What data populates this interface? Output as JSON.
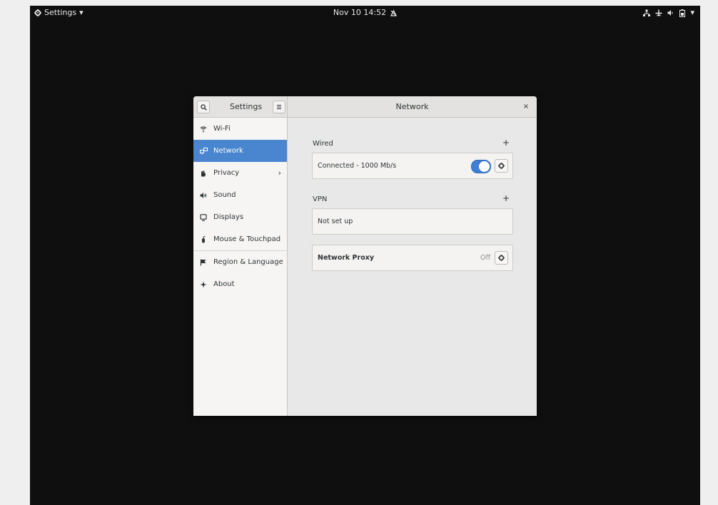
{
  "topbar": {
    "app_menu_label": "Settings",
    "app_menu_arrow": "▾",
    "clock": "Nov 10  14:52",
    "notification_icon": "alarm-icon",
    "tray_arrow": "▾"
  },
  "window": {
    "sidebar_title": "Settings",
    "page_title": "Network",
    "close_glyph": "×"
  },
  "sidebar": {
    "items": [
      {
        "label": "Wi-Fi",
        "icon": "wifi-icon"
      },
      {
        "label": "Network",
        "icon": "network-icon",
        "active": true
      },
      {
        "label": "Privacy",
        "icon": "privacy-icon",
        "chevron": "›"
      },
      {
        "label": "Sound",
        "icon": "sound-icon"
      },
      {
        "label": "Displays",
        "icon": "display-icon"
      },
      {
        "label": "Mouse & Touchpad",
        "icon": "mouse-icon"
      },
      {
        "label": "Region & Language",
        "icon": "flag-icon"
      },
      {
        "label": "About",
        "icon": "about-icon"
      }
    ]
  },
  "network": {
    "wired": {
      "heading": "Wired",
      "add_glyph": "+",
      "status": "Connected - 1000 Mb/s",
      "enabled": true
    },
    "vpn": {
      "heading": "VPN",
      "add_glyph": "+",
      "status": "Not set up"
    },
    "proxy": {
      "label": "Network Proxy",
      "state": "Off"
    }
  },
  "colors": {
    "accent": "#4a86cf",
    "toggle_on": "#3f7ed3",
    "desktop": "#0f0f0f"
  }
}
